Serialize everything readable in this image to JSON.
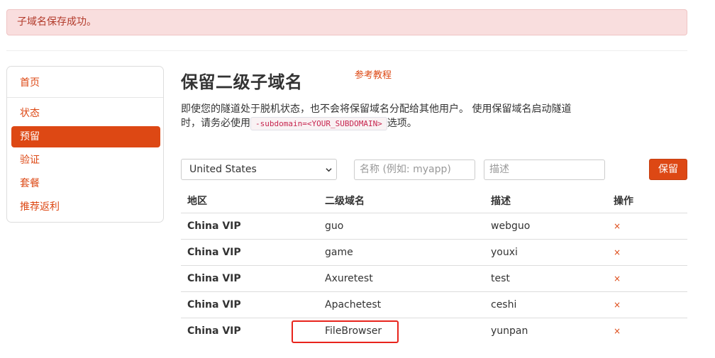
{
  "alert": {
    "text": "子域名保存成功。"
  },
  "sidebar": {
    "items": [
      {
        "label": "首页"
      },
      {
        "label": "状态"
      },
      {
        "label": "预留",
        "active": true
      },
      {
        "label": "验证"
      },
      {
        "label": "套餐"
      },
      {
        "label": "推荐返利"
      }
    ]
  },
  "page": {
    "title": "保留二级子域名",
    "help_link": "参考教程",
    "desc_line1": "即使您的隧道处于脱机状态，也不会将保留域名分配给其他用户。 使用保留域名启动隧道",
    "desc_line2_a": "时，请务必使用",
    "desc_code": "-subdomain=<YOUR_SUBDOMAIN>",
    "desc_line2_b": "选项。"
  },
  "form": {
    "region_value": "United States",
    "name_placeholder": "名称 (例如: myapp)",
    "desc_placeholder": "描述",
    "save_label": "保留"
  },
  "table": {
    "headers": {
      "region": "地区",
      "subdomain": "二级域名",
      "description": "描述",
      "action": "操作"
    },
    "delete_glyph": "×",
    "rows": [
      {
        "region": "China VIP",
        "subdomain": "guo",
        "description": "webguo"
      },
      {
        "region": "China VIP",
        "subdomain": "game",
        "description": "youxi"
      },
      {
        "region": "China VIP",
        "subdomain": "Axuretest",
        "description": "test"
      },
      {
        "region": "China VIP",
        "subdomain": "Apachetest",
        "description": "ceshi"
      },
      {
        "region": "China VIP",
        "subdomain": "FileBrowser",
        "description": "yunpan"
      }
    ]
  },
  "colors": {
    "accent": "#dd4814",
    "alert_bg": "#f9dede",
    "highlight": "#e8241c"
  }
}
